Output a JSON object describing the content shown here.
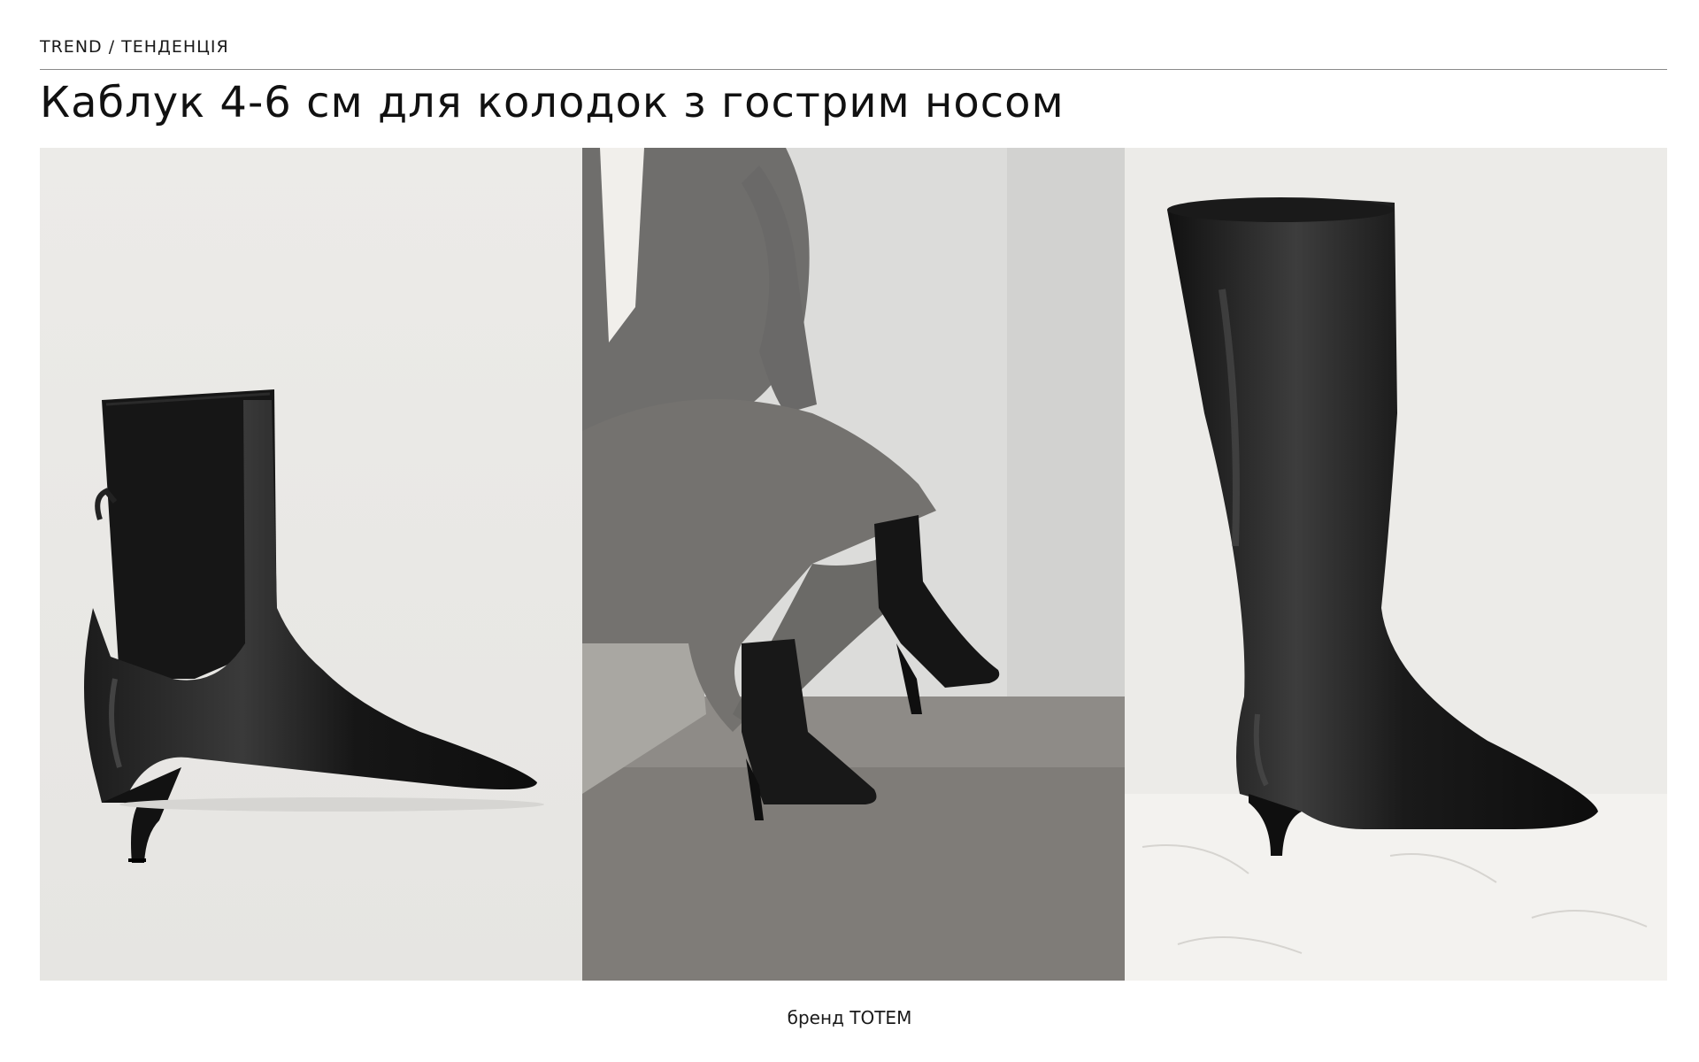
{
  "header": {
    "kicker": "TREND / ТЕНДЕНЦІЯ",
    "title": "Каблук 4-6 см для колодок з гострим носом"
  },
  "images": [
    {
      "name": "ankle-boot-photo",
      "subject": "black leather pointed-toe ankle boot with elastic shaft"
    },
    {
      "name": "model-wearing-boots-photo",
      "subject": "seated model in grey knit dress wearing black pointed ankle boots"
    },
    {
      "name": "knee-high-boot-photo",
      "subject": "black leather pointed-toe knee-high boot on marble floor"
    }
  ],
  "caption": "бренд TOTEM",
  "colors": {
    "background": "#ffffff",
    "rule": "#8a8a8a",
    "text": "#111111"
  }
}
